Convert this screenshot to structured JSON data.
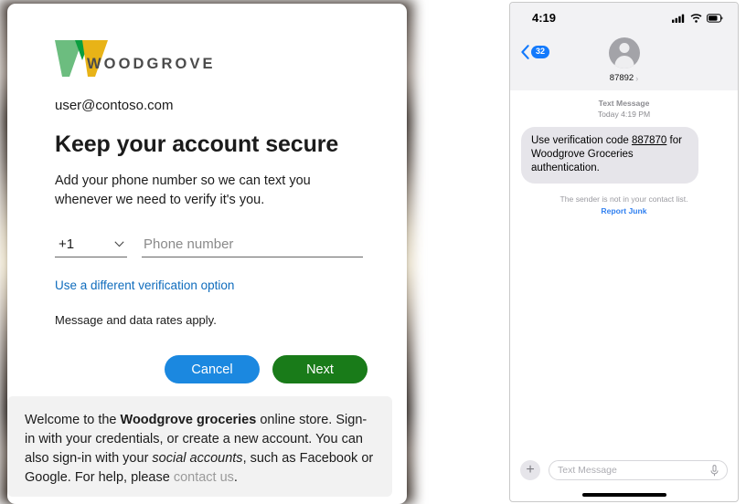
{
  "signin": {
    "brand": {
      "wordmark": "WOODGROVE",
      "logo_colors": {
        "light_green": "#6cbd7f",
        "dark_green": "#0a9e3f",
        "amber": "#e8b317"
      }
    },
    "account_email": "user@contoso.com",
    "title": "Keep your account secure",
    "description": "Add your phone number so we can text you whenever we need to verify it's you.",
    "country_code": {
      "value": "+1",
      "icon": "chevron-down-icon"
    },
    "phone_input": {
      "value": "",
      "placeholder": "Phone number"
    },
    "alt_verification_link": "Use a different verification option",
    "rates_note": "Message and data rates apply.",
    "buttons": {
      "cancel": "Cancel",
      "next": "Next",
      "cancel_color": "#1b88e0",
      "next_color": "#197b19"
    },
    "footer": {
      "part1": "Welcome to the ",
      "bold1": "Woodgrove groceries",
      "part2": " online store. Sign-in with your credentials, or create a new account. You can also sign-in with your ",
      "italic1": "social accounts",
      "part3": ", such as Facebook or Google. For help, please ",
      "link": "contact us",
      "part4": "."
    }
  },
  "phone": {
    "status_bar": {
      "time": "4:19",
      "icons": [
        "signal-icon",
        "wifi-icon",
        "battery-icon"
      ]
    },
    "header": {
      "back_badge": "32",
      "contact_name": "87892",
      "avatar": "person-avatar-icon"
    },
    "thread": {
      "meta_label": "Text Message",
      "meta_time": "Today 4:19 PM",
      "message": {
        "pre_code": "Use verification code ",
        "code": "887870",
        "post_code": " for Woodgrove Groceries authentication."
      },
      "sender_note": "The sender is not in your contact list.",
      "report_junk": "Report Junk"
    },
    "input_bar": {
      "plus": "+",
      "placeholder": "Text Message",
      "mic": "microphone-icon"
    }
  }
}
